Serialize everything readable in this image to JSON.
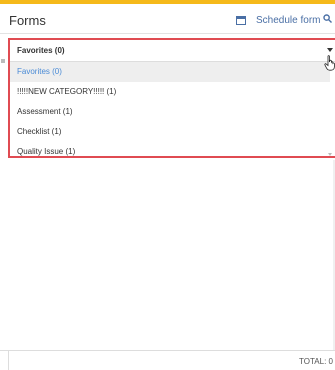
{
  "header": {
    "title": "Forms",
    "schedule_label": "Schedule form",
    "accent_color": "#f5b91a"
  },
  "dropdown": {
    "selected": "Favorites (0)",
    "options": [
      {
        "label": "Favorites (0)",
        "selected": true
      },
      {
        "label": "!!!!!NEW CATEGORY!!!!! (1)",
        "selected": false
      },
      {
        "label": "Assessment (1)",
        "selected": false
      },
      {
        "label": "Checklist (1)",
        "selected": false
      },
      {
        "label": "Quality Issue (1)",
        "selected": false
      }
    ],
    "highlight_color": "#e04b52"
  },
  "footer": {
    "total_label": "TOTAL:",
    "total_value": "0"
  },
  "icons": {
    "schedule": "calendar-icon",
    "search": "search-icon",
    "caret": "caret-down-icon",
    "cursor": "hand-pointer-icon"
  }
}
